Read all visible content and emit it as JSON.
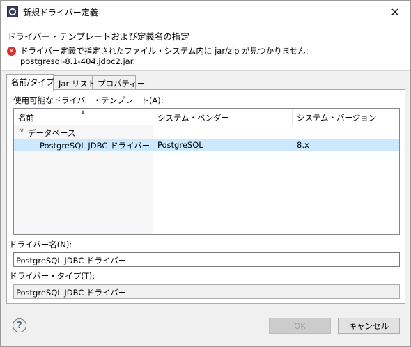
{
  "window": {
    "title": "新規ドライバー定義",
    "close_glyph": "✕"
  },
  "header": {
    "title": "ドライバー・テンプレートおよび定義名の指定",
    "error_message": "ドライバー定義で指定されたファイル・システム内に jar/zip が見つかりません: postgresql-8.1-404.jdbc2.jar.",
    "error_icon": "error-icon"
  },
  "tabs": [
    {
      "label": "名前/タイプ",
      "active": true
    },
    {
      "label": "Jar リスト",
      "active": false
    },
    {
      "label": "プロパティー",
      "active": false
    }
  ],
  "templates": {
    "label": "使用可能なドライバー・テンプレート(A):",
    "columns": [
      "名前",
      "システム・ベンダー",
      "システム・バージョン"
    ],
    "category": "データベース",
    "rows": [
      {
        "name": "PostgreSQL JDBC ドライバー",
        "vendor": "PostgreSQL",
        "version": "8.x",
        "selected": true
      }
    ]
  },
  "driver_name": {
    "label": "ドライバー名(N):",
    "value": "PostgreSQL JDBC ドライバー"
  },
  "driver_type": {
    "label": "ドライバー・タイプ(T):",
    "value": "PostgreSQL JDBC ドライバー"
  },
  "footer": {
    "help_glyph": "?",
    "ok_label": "OK",
    "ok_enabled": false,
    "cancel_label": "キャンセル"
  },
  "colors": {
    "selection": "#cce8ff",
    "error": "#d9332f",
    "border": "#adadad"
  }
}
